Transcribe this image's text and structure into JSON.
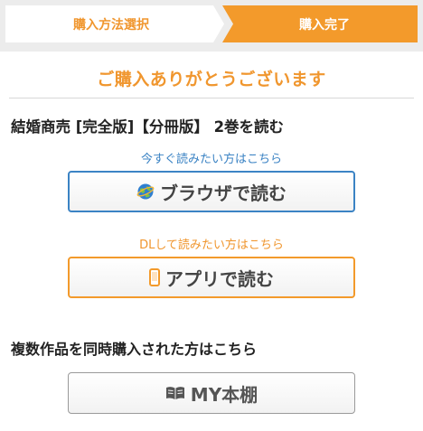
{
  "steps": {
    "step1": "購入方法選択",
    "step2": "購入完了"
  },
  "thanks": "ご購入ありがとうございます",
  "book_title": "結婚商売 [完全版]【分冊版】 2巻を読む",
  "browser": {
    "lead": "今すぐ読みたい方はこちら",
    "button": "ブラウザで読む"
  },
  "app": {
    "lead": "DLして読みたい方はこちら",
    "button": "アプリで読む"
  },
  "multi": "複数作品を同時購入された方はこちら",
  "shelf": {
    "button": "MY本棚"
  },
  "colors": {
    "accent_orange": "#f39a2b",
    "link_blue": "#3b83c4"
  }
}
